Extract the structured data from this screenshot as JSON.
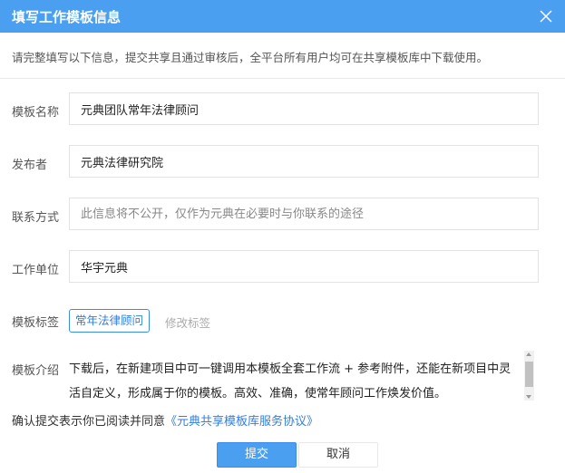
{
  "dialog": {
    "title": "填写工作模板信息",
    "intro": "请完整填写以下信息，提交共享且通过审核后，全平台所有用户均可在共享模板库中下载使用。"
  },
  "form": {
    "template_name": {
      "label": "模板名称",
      "value": "元典团队常年法律顾问"
    },
    "publisher": {
      "label": "发布者",
      "value": "元典法律研究院"
    },
    "contact": {
      "label": "联系方式",
      "value": "",
      "placeholder": "此信息将不公开，仅作为元典在必要时与你联系的途径"
    },
    "organization": {
      "label": "工作单位",
      "value": "华宇元典"
    },
    "tags": {
      "label": "模板标签",
      "items": [
        "常年法律顾问"
      ],
      "edit_label": "修改标签"
    },
    "description": {
      "label": "模板介绍",
      "value": "下载后，在新建项目中可一键调用本模板全套工作流 + 参考附件，还能在新项目中灵活自定义，形成属于你的模板。高效、准确，使常年顾问工作焕发价值。"
    }
  },
  "agreement": {
    "text": "确认提交表示你已阅读并同意",
    "link": "《元典共享模板库服务协议》"
  },
  "buttons": {
    "submit": "提交",
    "cancel": "取消"
  },
  "colors": {
    "header": "#4a9ff0",
    "link": "#2f7fe0"
  }
}
